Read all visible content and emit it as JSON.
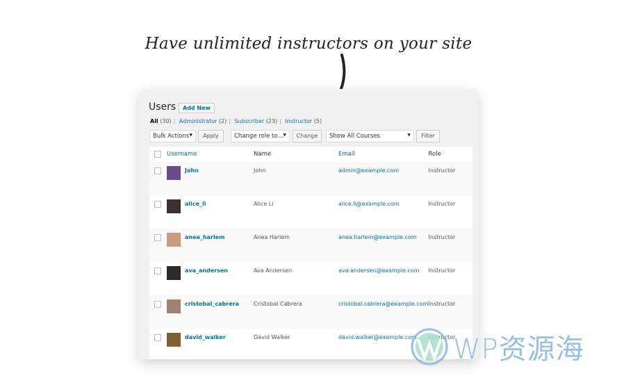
{
  "headline": "Have unlimited instructors on your site",
  "page": {
    "title": "Users",
    "add_new": "Add New"
  },
  "filters": [
    {
      "label": "All",
      "count": "(30)"
    },
    {
      "label": "Administrator",
      "count": "(2)"
    },
    {
      "label": "Subscriber",
      "count": "(23)"
    },
    {
      "label": "Instructor",
      "count": "(5)"
    }
  ],
  "toolbar": {
    "bulk_actions": "Bulk Actions",
    "apply": "Apply",
    "change_role": "Change role to…",
    "change": "Change",
    "courses": "Show All Courses",
    "filter": "Filter"
  },
  "columns": {
    "username": "Username",
    "name": "Name",
    "email": "Email",
    "role": "Role"
  },
  "users": [
    {
      "username": "John",
      "name": "John",
      "email": "admin@example.com",
      "role": "Instructor",
      "avatar_color": "#6a4c8c"
    },
    {
      "username": "alice_li",
      "name": "Alice Li",
      "email": "alice.li@example.com",
      "role": "Instructor",
      "avatar_color": "#3a3030"
    },
    {
      "username": "anea_harlem",
      "name": "Anea Harlem",
      "email": "anea.harlem@example.com",
      "role": "Instructor",
      "avatar_color": "#c89a80"
    },
    {
      "username": "ava_andersen",
      "name": "Ava Andersen",
      "email": "ava.andersen@example.com",
      "role": "Instructor",
      "avatar_color": "#2a2a2a"
    },
    {
      "username": "cristobal_cabrera",
      "name": "Cristobal Cabrera",
      "email": "cristobal.cabrera@example.com",
      "role": "Instructor",
      "avatar_color": "#a08070"
    },
    {
      "username": "david_walker",
      "name": "David Walker",
      "email": "david.walker@example.com",
      "role": "Instructor",
      "avatar_color": "#806030"
    }
  ],
  "watermark": "WP资源海"
}
